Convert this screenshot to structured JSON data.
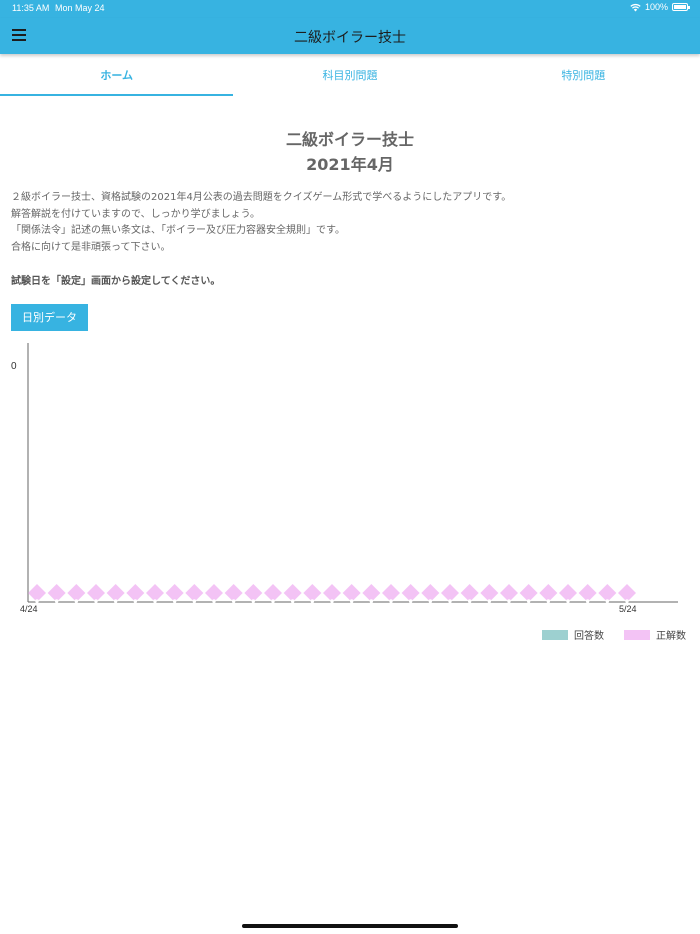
{
  "status_bar": {
    "time": "11:35 AM",
    "date": "Mon May 24",
    "battery": "100%",
    "battery_level": 1.0
  },
  "app_bar": {
    "title": "二級ボイラー技士",
    "menu_icon": "menu-icon"
  },
  "tabs": [
    {
      "label": "ホーム",
      "active": true
    },
    {
      "label": "科目別問題",
      "active": false
    },
    {
      "label": "特別問題",
      "active": false
    }
  ],
  "hero": {
    "title": "二級ボイラー技士",
    "subtitle": "2021年4月"
  },
  "description": [
    "２級ボイラー技士、資格試験の2021年4月公表の過去問題をクイズゲーム形式で学べるようにしたアプリです。",
    "解答解説を付けていますので、しっかり学びましょう。",
    "「関係法令」記述の無い条文は、「ボイラー及び圧力容器安全規則」です。",
    "合格に向けて是非頑張って下さい。"
  ],
  "notice": "試験日を「設定」画面から設定してください。",
  "daily_button": {
    "label": "日別データ"
  },
  "colors": {
    "accent": "#37b3e1",
    "answers": "#9dd0d0",
    "correct": "#f3c3f5"
  },
  "chart_data": {
    "type": "area",
    "x_start_label": "4/24",
    "x_end_label": "5/24",
    "y_tick_label": "0",
    "points_count": 31,
    "series": [
      {
        "name": "回答数",
        "values": [
          0,
          0,
          0,
          0,
          0,
          0,
          0,
          0,
          0,
          0,
          0,
          0,
          0,
          0,
          0,
          0,
          0,
          0,
          0,
          0,
          0,
          0,
          0,
          0,
          0,
          0,
          0,
          0,
          0,
          0,
          0
        ]
      },
      {
        "name": "正解数",
        "values": [
          0,
          0,
          0,
          0,
          0,
          0,
          0,
          0,
          0,
          0,
          0,
          0,
          0,
          0,
          0,
          0,
          0,
          0,
          0,
          0,
          0,
          0,
          0,
          0,
          0,
          0,
          0,
          0,
          0,
          0,
          0
        ]
      }
    ],
    "ylim": [
      0,
      0
    ],
    "legend": "bottom-right"
  }
}
